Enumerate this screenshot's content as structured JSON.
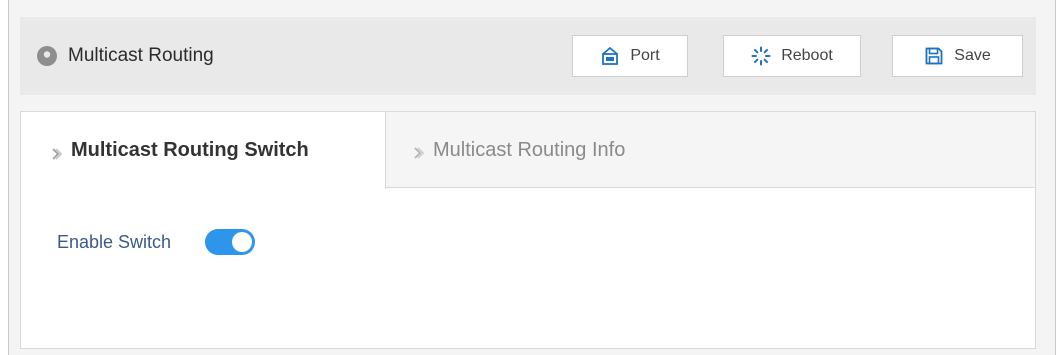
{
  "header": {
    "title": "Multicast Routing",
    "buttons": {
      "port": "Port",
      "reboot": "Reboot",
      "save": "Save"
    }
  },
  "tabs": [
    {
      "label": "Multicast Routing Switch",
      "active": true
    },
    {
      "label": "Multicast Routing Info",
      "active": false
    }
  ],
  "form": {
    "enable_switch_label": "Enable Switch",
    "enable_switch_on": true
  },
  "colors": {
    "accent": "#2d95ea",
    "icon_blue": "#1e73be",
    "label_text": "#3a5a8a"
  },
  "icons": {
    "title": "location-pin-icon",
    "port": "port-icon",
    "reboot": "reboot-icon",
    "save": "save-icon",
    "tab_chevron": "chevron-right-icon"
  }
}
